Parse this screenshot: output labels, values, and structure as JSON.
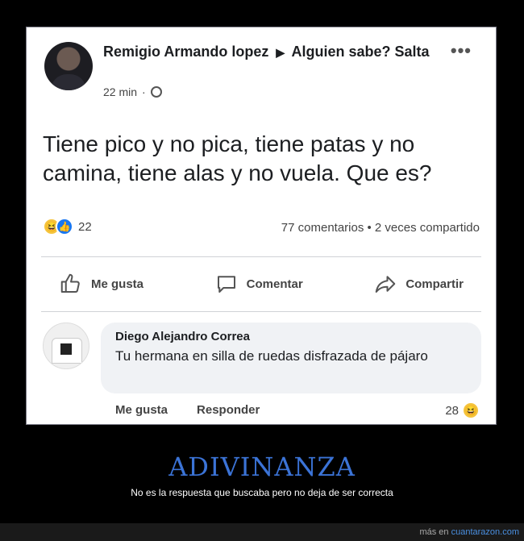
{
  "post": {
    "author": "Remigio Armando lopez",
    "group": "Alguien sabe? Salta",
    "time": "22 min",
    "more": "•••",
    "text": "Tiene pico y no pica, tiene patas y no camina, tiene alas y no vuela. Que es?",
    "reaction_count": "22",
    "stats": "77 comentarios • 2 veces compartido",
    "actions": {
      "like": "Me gusta",
      "comment": "Comentar",
      "share": "Compartir"
    }
  },
  "comment": {
    "author": "Diego Alejandro Correa",
    "text": "Tu hermana en silla de ruedas disfrazada de pájaro",
    "like": "Me gusta",
    "reply": "Responder",
    "reaction_count": "28"
  },
  "caption": {
    "title": "ADIVINANZA",
    "subtitle": "No es la respuesta que buscaba pero no deja de ser correcta"
  },
  "footer": {
    "prefix": "más en",
    "site": "cuantarazon.com"
  },
  "colors": {
    "caption": "#3b73d6",
    "like_blue": "#1877f2",
    "laugh_yellow": "#f5c43c"
  }
}
